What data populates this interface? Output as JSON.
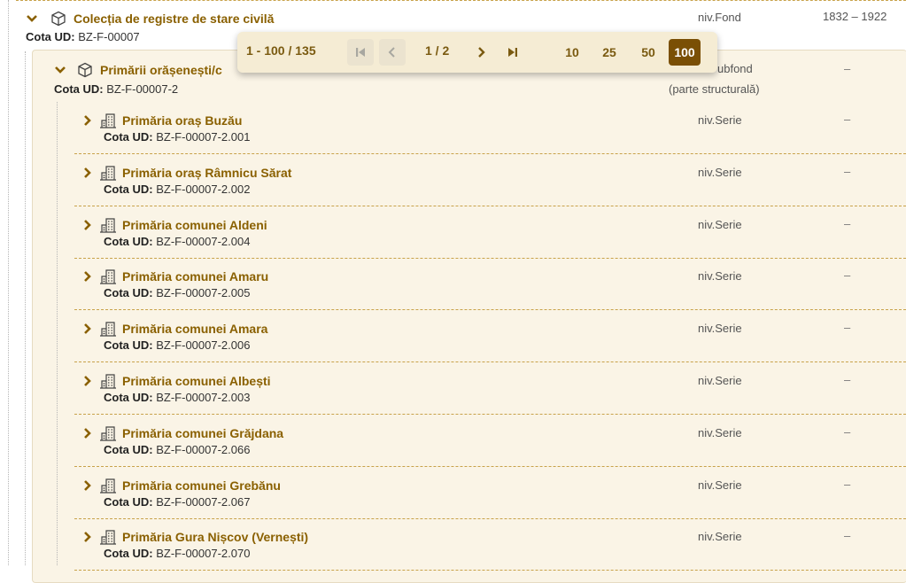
{
  "root": {
    "title": "Colecția de registre de stare civilă",
    "cota_label": "Cota UD:",
    "cota_value": "BZ-F-00007",
    "level": "niv.Fond",
    "dates": "1832 – 1922"
  },
  "subfond": {
    "title": "Primării orășenești/c",
    "cota_label": "Cota UD:",
    "cota_value": "BZ-F-00007-2",
    "level": "ubfond",
    "level_note": "(parte structurală)",
    "dates": "–"
  },
  "series": [
    {
      "title": "Primăria oraș Buzău",
      "cota_label": "Cota UD:",
      "cota_value": "BZ-F-00007-2.001",
      "level": "niv.Serie",
      "dates": "–"
    },
    {
      "title": "Primăria oraș Râmnicu Sărat",
      "cota_label": "Cota UD:",
      "cota_value": "BZ-F-00007-2.002",
      "level": "niv.Serie",
      "dates": "–"
    },
    {
      "title": "Primăria comunei Aldeni",
      "cota_label": "Cota UD:",
      "cota_value": "BZ-F-00007-2.004",
      "level": "niv.Serie",
      "dates": "–"
    },
    {
      "title": "Primăria comunei Amaru",
      "cota_label": "Cota UD:",
      "cota_value": "BZ-F-00007-2.005",
      "level": "niv.Serie",
      "dates": "–"
    },
    {
      "title": "Primăria comunei Amara",
      "cota_label": "Cota UD:",
      "cota_value": "BZ-F-00007-2.006",
      "level": "niv.Serie",
      "dates": "–"
    },
    {
      "title": "Primăria comunei Albești",
      "cota_label": "Cota UD:",
      "cota_value": "BZ-F-00007-2.003",
      "level": "niv.Serie",
      "dates": "–"
    },
    {
      "title": "Primăria comunei Grăjdana",
      "cota_label": "Cota UD:",
      "cota_value": "BZ-F-00007-2.066",
      "level": "niv.Serie",
      "dates": "–"
    },
    {
      "title": "Primăria comunei Grebănu",
      "cota_label": "Cota UD:",
      "cota_value": "BZ-F-00007-2.067",
      "level": "niv.Serie",
      "dates": "–"
    },
    {
      "title": "Primăria Gura Nișcov (Vernești)",
      "cota_label": "Cota UD:",
      "cota_value": "BZ-F-00007-2.070",
      "level": "niv.Serie",
      "dates": "–"
    }
  ],
  "pager": {
    "range": "1 - 100 / 135",
    "page": "1 / 2",
    "page_sizes": [
      "10",
      "25",
      "50",
      "100"
    ],
    "selected_size": "100"
  },
  "colors": {
    "accent": "#8a6000",
    "panel_bg": "#faf4e6",
    "pager_bg": "#f5ecd4",
    "selected_bg": "#7a4f05"
  },
  "icons": {
    "expand": "chevron-down-icon",
    "collapse": "chevron-right-icon",
    "fond": "box-icon",
    "series": "building-icon"
  }
}
